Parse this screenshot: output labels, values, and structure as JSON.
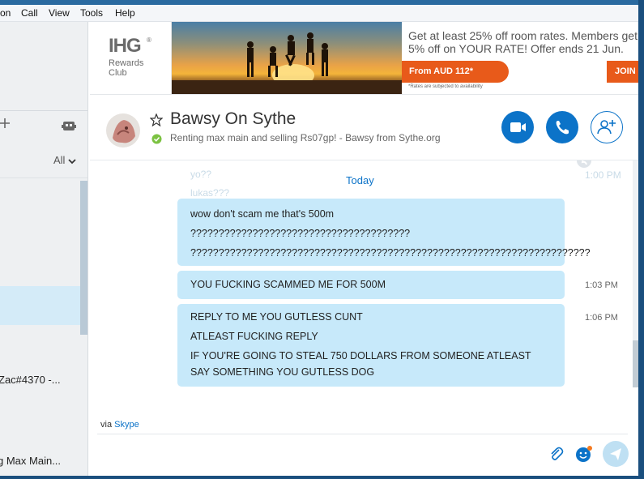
{
  "menu": {
    "items": [
      "on",
      "Call",
      "View",
      "Tools",
      "Help"
    ]
  },
  "sidebar": {
    "filter_label": "All",
    "contacts": [
      {
        "label": "Zac#4370 -..."
      },
      {
        "label": "g Max Main..."
      }
    ]
  },
  "ad": {
    "brand": "IHG",
    "brand_sub": "Rewards Club",
    "headline": "Get at least 25% off room rates. Members get 5% off on YOUR RATE! Offer ends 21 Jun.",
    "price": "From AUD 112*",
    "fine_print": "*Rates are subjected to availability",
    "join_label": "JOIN I",
    "accent_color": "#e85a1a"
  },
  "chat": {
    "contact_name": "Bawsy On Sythe",
    "mood_message": "Renting max main and selling Rs07gp! - Bawsy from Sythe.org",
    "status_color": "#7cc242",
    "day_separator": "Today",
    "ghost_lines": [
      "yo??",
      "lukas???",
      "1:00 PM"
    ],
    "messages": [
      {
        "time": "",
        "lines": [
          "wow don't scam me that's 500m",
          "???????????????????????????????????????",
          "???????????????????????????????????????????????????????????????????????"
        ]
      },
      {
        "time": "1:03 PM",
        "lines": [
          "YOU FUCKING SCAMMED ME FOR 500M"
        ]
      },
      {
        "time": "1:06 PM",
        "lines": [
          "REPLY TO ME YOU GUTLESS CUNT",
          "ATLEAST FUCKING REPLY",
          "IF YOU'RE GOING TO STEAL 750 DOLLARS FROM SOMEONE ATLEAST",
          "SAY SOMETHING YOU GUTLESS DOG"
        ]
      }
    ],
    "via_prefix": "via",
    "via_link": "Skype"
  },
  "colors": {
    "accent": "#0c73c8",
    "bubble": "#c7e9fa"
  }
}
